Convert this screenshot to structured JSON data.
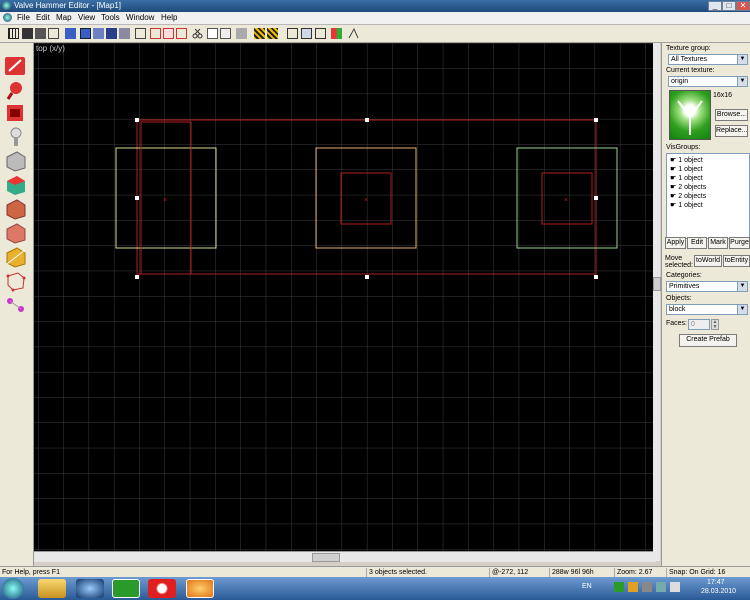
{
  "window": {
    "title": "Valve Hammer Editor - [Map1]"
  },
  "menu": [
    "File",
    "Edit",
    "Map",
    "View",
    "Tools",
    "Window",
    "Help"
  ],
  "viewport": {
    "label": "top (x/y)"
  },
  "panel": {
    "texture_group_label": "Texture group:",
    "texture_group_value": "All Textures",
    "current_texture_label": "Current texture:",
    "current_texture_value": "origin",
    "texture_size": "16x16",
    "browse_label": "Browse...",
    "replace_label": "Replace...",
    "visgroups_label": "VisGroups:",
    "visgroups": [
      "1 object",
      "1 object",
      "1 object",
      "2 objects",
      "2 objects",
      "1 object"
    ],
    "apply_label": "Apply",
    "edit_label": "Edit",
    "mark_label": "Mark",
    "purge_label": "Purge",
    "move_selected_label": "Move selected:",
    "to_world_label": "toWorld",
    "to_entity_label": "toEntity",
    "categories_label": "Categories:",
    "categories_value": "Primitives",
    "objects_label": "Objects:",
    "objects_value": "block",
    "faces_label": "Faces:",
    "faces_value": "0",
    "create_prefab_label": "Create Prefab"
  },
  "status": {
    "help": "For Help, press F1",
    "selection": "3 objects selected.",
    "coords": "@-272, 112",
    "size": "288w 96l 96h",
    "zoom": "Zoom: 2.67",
    "snap": "Snap: On Grid: 16"
  },
  "taskbar": {
    "lang": "EN",
    "time": "17:47",
    "date": "28.03.2010"
  },
  "colors": {
    "grid": "#3c3c3c",
    "selection": "#b01e1e",
    "brush_yellow": "#d8d890",
    "brush_orange": "#e0b070",
    "brush_green": "#9ad090"
  }
}
